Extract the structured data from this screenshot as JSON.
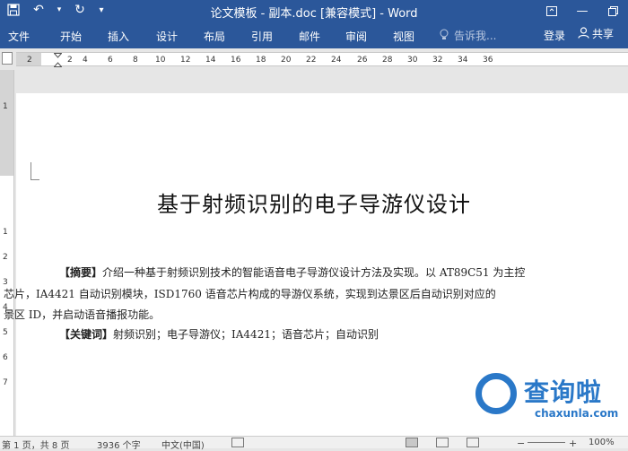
{
  "window": {
    "title": "论文模板 - 副本.doc [兼容模式] - Word",
    "accent_color": "#2b579a"
  },
  "ribbon": {
    "tabs": [
      "文件",
      "开始",
      "插入",
      "设计",
      "布局",
      "引用",
      "邮件",
      "审阅",
      "视图"
    ],
    "tell_me": "告诉我...",
    "sign_in": "登录",
    "share": "共享"
  },
  "ruler": {
    "ticks": [
      "2",
      "2",
      "4",
      "6",
      "8",
      "10",
      "12",
      "14",
      "16",
      "18",
      "20",
      "22",
      "24",
      "26",
      "28",
      "30",
      "32",
      "34",
      "36"
    ],
    "vertical_ticks": [
      "1",
      "1",
      "2",
      "3",
      "4",
      "5",
      "6",
      "7"
    ]
  },
  "document": {
    "title": "基于射频识别的电子导游仪设计",
    "abstract_label": "【摘要】",
    "abstract_line1": "介绍一种基于射频识别技术的智能语音电子导游仪设计方法及实现。以 AT89C51 为主控",
    "abstract_line2": "芯片，IA4421 自动识别模块，ISD1760 语音芯片构成的导游仪系统，实现到达景区后自动识别对应的",
    "abstract_line3": "景区 ID，并启动语音播报功能。",
    "keywords_label": "【关键词】",
    "keywords": "射频识别；电子导游仪；IA4421；语音芯片；自动识别"
  },
  "watermark": {
    "text": "查询啦",
    "sub": "chaxunla.com"
  },
  "status": {
    "page": "第 1 页，共 8 页",
    "words": "3936 个字",
    "language": "中文(中国)",
    "zoom": "100%"
  }
}
